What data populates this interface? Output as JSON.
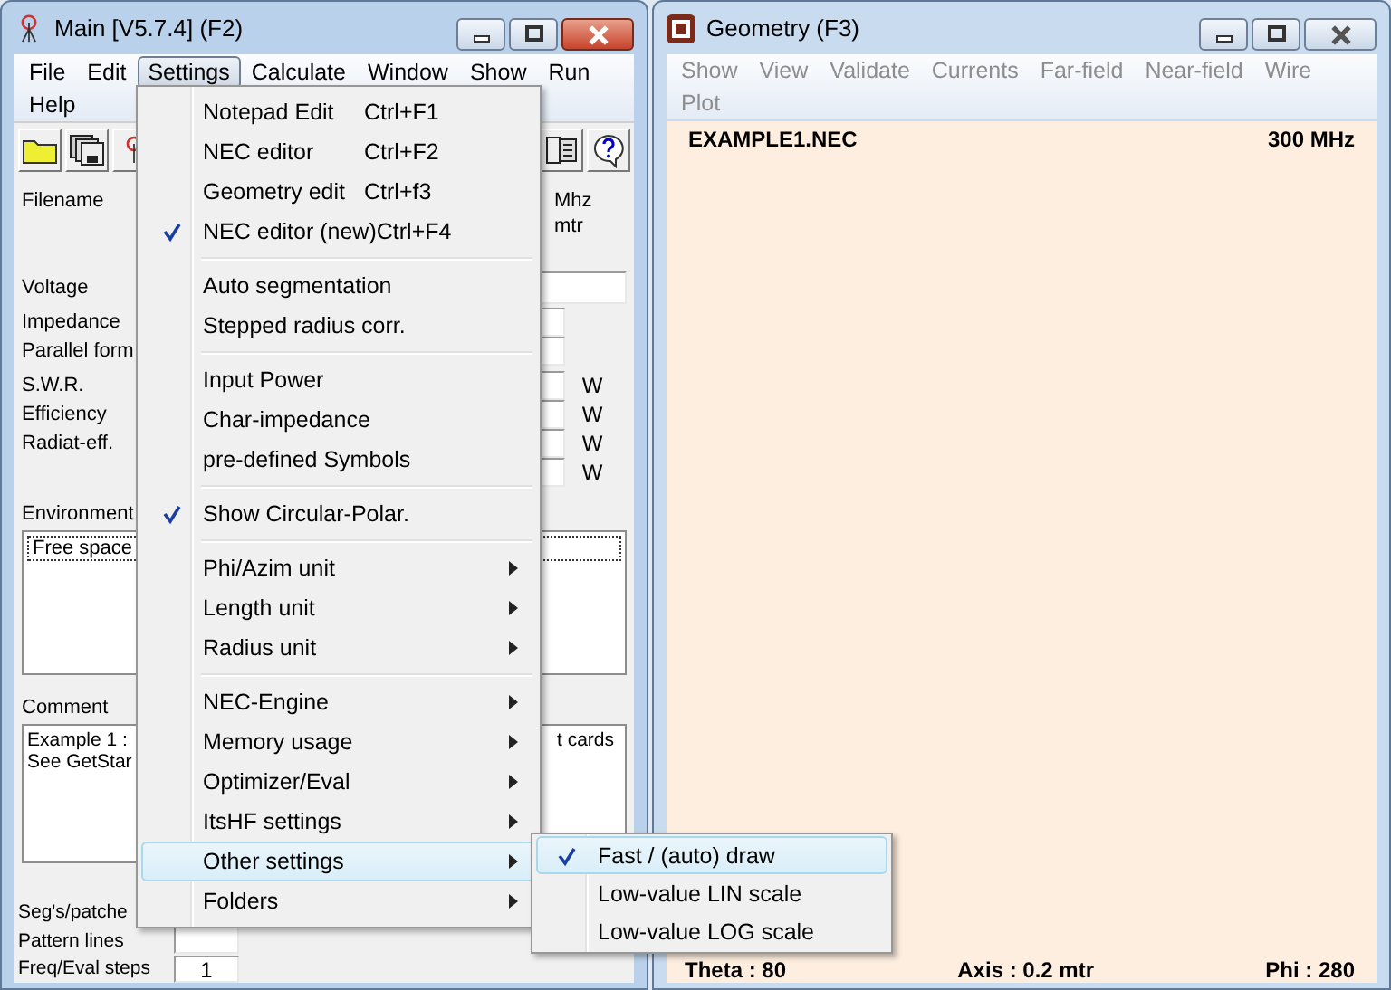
{
  "main_window": {
    "title": "Main [V5.7.4]  (F2)",
    "active": true,
    "menu": [
      {
        "label": "File",
        "selected": false
      },
      {
        "label": "Edit",
        "selected": false
      },
      {
        "label": "Settings",
        "selected": true
      },
      {
        "label": "Calculate",
        "selected": false
      },
      {
        "label": "Window",
        "selected": false
      },
      {
        "label": "Show",
        "selected": false
      },
      {
        "label": "Run",
        "selected": false
      },
      {
        "label": "Help",
        "selected": false
      }
    ],
    "form_rows": [
      {
        "kind": "units",
        "label": "Filename",
        "units": [
          "Mhz",
          "mtr"
        ]
      },
      {
        "kind": "wide",
        "label": "Voltage"
      },
      {
        "kind": "field",
        "label": "Impedance"
      },
      {
        "kind": "field",
        "label": "Parallel form"
      },
      {
        "kind": "unit",
        "label": "S.W.R.",
        "unit": "W"
      },
      {
        "kind": "unit",
        "label": "Efficiency",
        "unit": "W"
      },
      {
        "kind": "unit",
        "label": "Radiat-eff.",
        "unit": "W"
      },
      {
        "kind": "unit",
        "unit": "W"
      }
    ],
    "environment": {
      "label": "Environment",
      "items": [
        {
          "label": "Free space",
          "selected": true
        }
      ]
    },
    "comment": {
      "label": "Comment",
      "lines": [
        "Example 1 :",
        "See GetStar"
      ],
      "right_text": "t cards"
    },
    "bottom_rows": [
      {
        "kind": "label",
        "label": "Seg's/patche"
      },
      {
        "kind": "field",
        "label": "Pattern lines"
      },
      {
        "kind": "field",
        "label": "Freq/Eval steps",
        "value": "1"
      }
    ]
  },
  "settings_menu": {
    "groups": [
      [
        {
          "kind": "command",
          "label": "Notepad Edit",
          "shortcut": "Ctrl+F1",
          "checked": false,
          "selected": false
        },
        {
          "kind": "command",
          "label": "NEC editor",
          "shortcut": "Ctrl+F2",
          "checked": false,
          "selected": false
        },
        {
          "kind": "command",
          "label": "Geometry edit",
          "shortcut": "Ctrl+f3",
          "checked": false,
          "selected": false
        },
        {
          "kind": "command",
          "label": "NEC editor (new)",
          "shortcut": "Ctrl+F4",
          "checked": true,
          "selected": false
        }
      ],
      [
        {
          "kind": "command",
          "label": "Auto segmentation",
          "checked": false,
          "selected": false
        },
        {
          "kind": "command",
          "label": "Stepped radius corr.",
          "checked": false,
          "selected": false
        }
      ],
      [
        {
          "kind": "command",
          "label": "Input Power",
          "checked": false,
          "selected": false
        },
        {
          "kind": "command",
          "label": "Char-impedance",
          "checked": false,
          "selected": false
        },
        {
          "kind": "command",
          "label": "pre-defined Symbols",
          "checked": false,
          "selected": false
        }
      ],
      [
        {
          "kind": "command",
          "label": "Show Circular-Polar.",
          "checked": true,
          "selected": false
        }
      ],
      [
        {
          "kind": "submenu",
          "label": "Phi/Azim unit",
          "checked": false,
          "selected": false
        },
        {
          "kind": "submenu",
          "label": "Length unit",
          "checked": false,
          "selected": false
        },
        {
          "kind": "submenu",
          "label": "Radius unit",
          "checked": false,
          "selected": false
        }
      ],
      [
        {
          "kind": "submenu",
          "label": "NEC-Engine",
          "checked": false,
          "selected": false
        },
        {
          "kind": "submenu",
          "label": "Memory usage",
          "checked": false,
          "selected": false
        },
        {
          "kind": "submenu",
          "label": "Optimizer/Eval",
          "checked": false,
          "selected": false
        },
        {
          "kind": "submenu",
          "label": "ItsHF settings",
          "checked": false,
          "selected": false
        },
        {
          "kind": "submenu",
          "label": "Other settings",
          "checked": false,
          "selected": true
        },
        {
          "kind": "submenu",
          "label": "Folders",
          "checked": false,
          "selected": false
        }
      ]
    ]
  },
  "other_settings_submenu": {
    "items": [
      {
        "label": "Fast / (auto) draw",
        "checked": true,
        "selected": true
      },
      {
        "label": "Low-value LIN scale",
        "checked": false,
        "selected": false
      },
      {
        "label": "Low-value LOG scale",
        "checked": false,
        "selected": false
      }
    ]
  },
  "geometry_window": {
    "title": "Geometry   (F3)",
    "active": false,
    "menu": [
      {
        "label": "Show",
        "disabled": true
      },
      {
        "label": "View",
        "disabled": true
      },
      {
        "label": "Validate",
        "disabled": true
      },
      {
        "label": "Currents",
        "disabled": true
      },
      {
        "label": "Far-field",
        "disabled": true
      },
      {
        "label": "Near-field",
        "disabled": true
      },
      {
        "label": "Wire",
        "disabled": true
      },
      {
        "label": "Plot",
        "disabled": true
      }
    ],
    "filename": "EXAMPLE1.NEC",
    "frequency": "300 MHz",
    "theta": "Theta : 80",
    "axis": "Axis : 0.2 mtr",
    "phi": "Phi : 280"
  }
}
